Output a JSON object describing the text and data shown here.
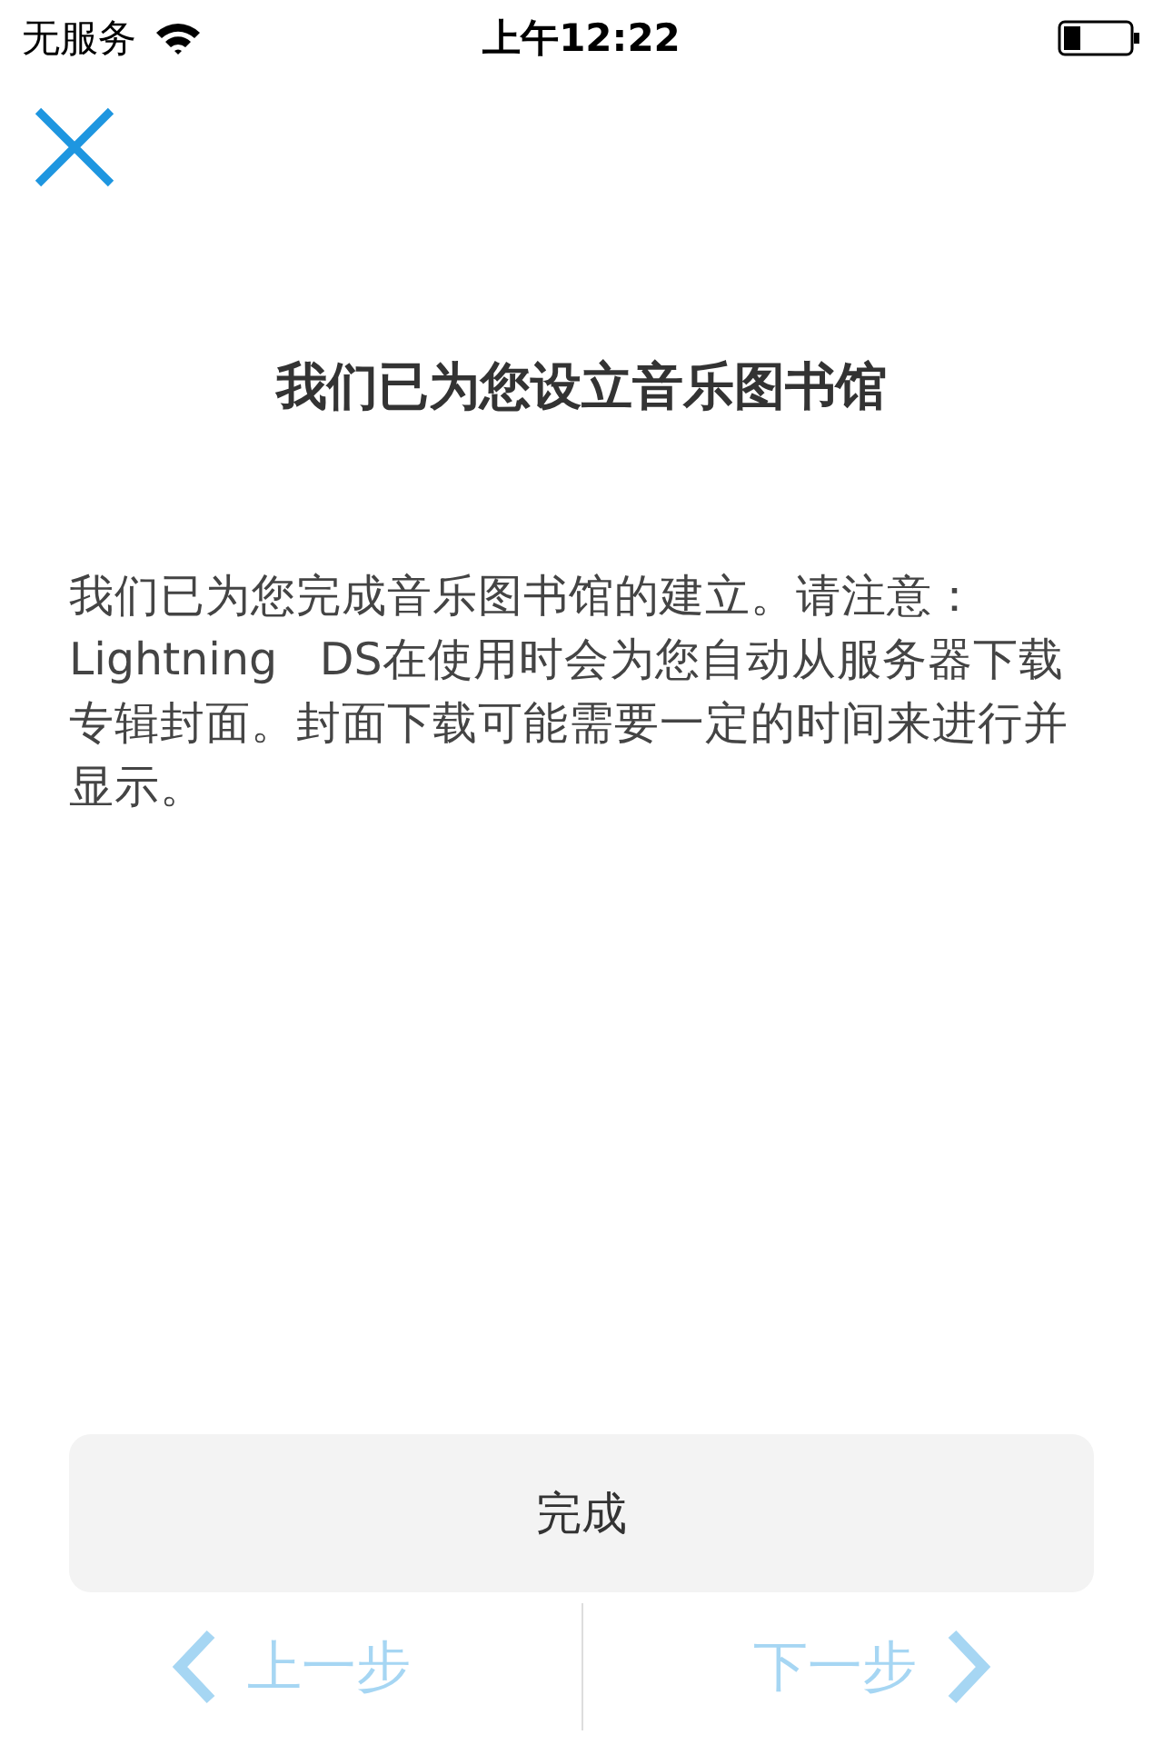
{
  "status_bar": {
    "carrier": "无服务",
    "time": "上午12:22"
  },
  "title": "我们已为您设立音乐图书馆",
  "message": "我们已为您完成音乐图书馆的建立。请注意：Lightning   DS在使用时会为您自动从服务器下载专辑封面。封面下载可能需要一定的时间来进行并显示。",
  "done_button": "完成",
  "nav": [
    {
      "kind": "prev",
      "label": "上一步",
      "disabled": true
    },
    {
      "kind": "next",
      "label": "下一步",
      "disabled": true
    }
  ]
}
